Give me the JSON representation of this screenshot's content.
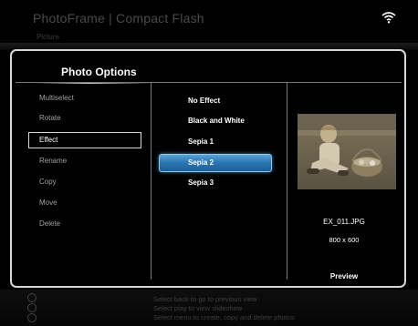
{
  "background": {
    "title": "PhotoFrame | Compact Flash",
    "subtitle": "Picture",
    "hints": [
      "Select back to go to previous view",
      "Select play to view slideshow",
      "Select menu to create, copy and delete photos"
    ]
  },
  "dialog": {
    "title": "Photo Options",
    "options": [
      {
        "label": "Multiselect",
        "selected": false
      },
      {
        "label": "Rotate",
        "selected": false
      },
      {
        "label": "Effect",
        "selected": true
      },
      {
        "label": "Rename",
        "selected": false
      },
      {
        "label": "Copy",
        "selected": false
      },
      {
        "label": "Move",
        "selected": false
      },
      {
        "label": "Delete",
        "selected": false
      }
    ],
    "effects": [
      {
        "label": "No Effect",
        "selected": false
      },
      {
        "label": "Black and White",
        "selected": false
      },
      {
        "label": "Sepia 1",
        "selected": false
      },
      {
        "label": "Sepia 2",
        "selected": true
      },
      {
        "label": "Sepia 3",
        "selected": false
      }
    ],
    "preview": {
      "file_name": "EX_011.JPG",
      "resolution": "800 x 600",
      "label": "Preview"
    }
  },
  "colors": {
    "selection_blue": "#2b78b5",
    "border": "#d6d6d6"
  }
}
